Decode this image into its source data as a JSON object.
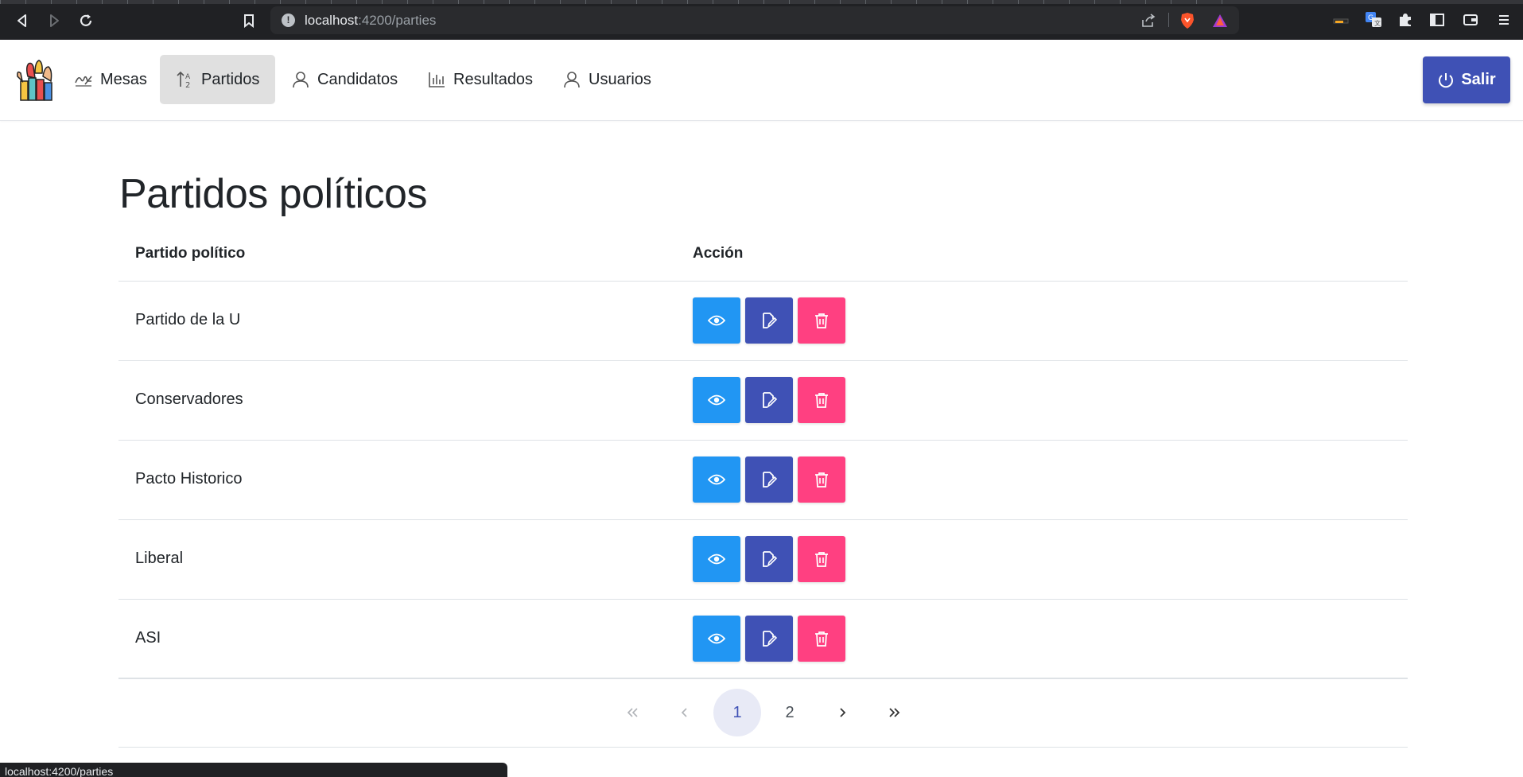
{
  "browser": {
    "url_host": "localhost",
    "url_path": ":4200/parties"
  },
  "navbar": {
    "items": [
      {
        "label": "Mesas",
        "icon": "signature-icon"
      },
      {
        "label": "Partidos",
        "icon": "sort-alpha-icon",
        "active": true
      },
      {
        "label": "Candidatos",
        "icon": "user-icon"
      },
      {
        "label": "Resultados",
        "icon": "chart-bar-icon"
      },
      {
        "label": "Usuarios",
        "icon": "user-icon"
      }
    ],
    "logout_label": "Salir"
  },
  "page": {
    "title": "Partidos políticos",
    "table": {
      "headers": [
        "Partido político",
        "Acción"
      ],
      "rows": [
        {
          "name": "Partido de la U"
        },
        {
          "name": "Conservadores"
        },
        {
          "name": "Pacto Historico"
        },
        {
          "name": "Liberal"
        },
        {
          "name": "ASI"
        }
      ]
    },
    "pagination": {
      "pages": [
        "1",
        "2"
      ],
      "current": "1"
    }
  },
  "status_bar": {
    "text": "localhost:4200/parties"
  },
  "colors": {
    "primary": "#3f51b5",
    "view": "#2196f3",
    "delete": "#ff4081"
  }
}
